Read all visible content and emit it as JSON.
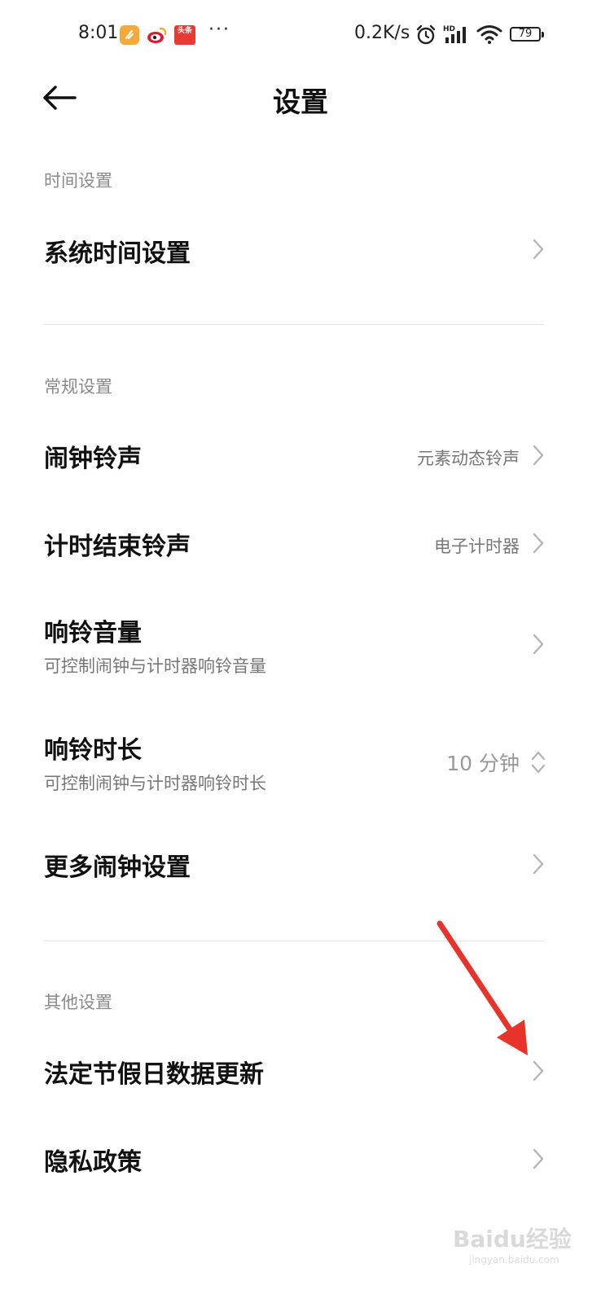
{
  "status_bar": {
    "time": "8:01",
    "app3_label": "头条",
    "more": "···",
    "network_speed": "0.2K/s",
    "signal_label": "HD",
    "battery": "79"
  },
  "header": {
    "title": "设置"
  },
  "sections": {
    "time": {
      "title": "时间设置",
      "items": [
        {
          "label": "系统时间设置"
        }
      ]
    },
    "general": {
      "title": "常规设置",
      "items": [
        {
          "label": "闹钟铃声",
          "value": "元素动态铃声"
        },
        {
          "label": "计时结束铃声",
          "value": "电子计时器"
        },
        {
          "label": "响铃音量",
          "subtitle": "可控制闹钟与计时器响铃音量"
        },
        {
          "label": "响铃时长",
          "subtitle": "可控制闹钟与计时器响铃时长",
          "value": "10 分钟"
        },
        {
          "label": "更多闹钟设置"
        }
      ]
    },
    "other": {
      "title": "其他设置",
      "items": [
        {
          "label": "法定节假日数据更新"
        },
        {
          "label": "隐私政策"
        }
      ]
    }
  },
  "watermark": {
    "text": "Baidu经验",
    "sub": "jingyan.baidu.com"
  },
  "colors": {
    "annotation_arrow": "#e8332b",
    "section_title": "#8a8a8a",
    "chevron": "#b5b5b5"
  }
}
